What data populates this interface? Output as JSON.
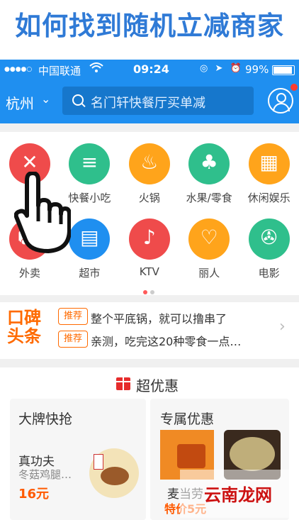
{
  "banner": {
    "title": "如何找到随机立减商家"
  },
  "status_bar": {
    "signal": "●●●●○",
    "carrier": "中国联通",
    "wifi": "wifi-icon",
    "time": "09:24",
    "icons": "◎ ➤ ⏰",
    "battery_pct": "99%",
    "battery_level": 0.99,
    "text_color": "#ffffff"
  },
  "nav": {
    "city": "杭州",
    "search_placeholder": "名门轩快餐厅买单减",
    "bg_color": "#1f8ff0"
  },
  "categories": [
    {
      "label": "",
      "icon": "fork-spoon-icon",
      "color": "#ef4b4b"
    },
    {
      "label": "快餐小吃",
      "icon": "burger-icon",
      "color": "#2fbf8c"
    },
    {
      "label": "火锅",
      "icon": "hotpot-icon",
      "color": "#ffa41b"
    },
    {
      "label": "水果/零食",
      "icon": "cherry-icon",
      "color": "#2fbf8c"
    },
    {
      "label": "休闲娱乐",
      "icon": "gameboy-icon",
      "color": "#ffa41b"
    },
    {
      "label": "外卖",
      "icon": "delivery-icon",
      "color": "#ef4b4b"
    },
    {
      "label": "超市",
      "icon": "basket-icon",
      "color": "#1f8ff0"
    },
    {
      "label": "KTV",
      "icon": "microphone-icon",
      "color": "#ef4b4b"
    },
    {
      "label": "丽人",
      "icon": "beauty-icon",
      "color": "#ffa41b"
    },
    {
      "label": "电影",
      "icon": "film-icon",
      "color": "#2fbf8c"
    }
  ],
  "pager": {
    "active": 0,
    "count": 2
  },
  "koubei": {
    "logo_line1": "口碑",
    "logo_line2": "头条",
    "items": [
      {
        "tag": "推荐",
        "text": "整个平底锅，就可以撸串了"
      },
      {
        "tag": "推荐",
        "text": "亲测，吃完这20种零食一点…"
      }
    ]
  },
  "deals": {
    "title": "超优惠",
    "brand_card": {
      "title": "大牌快抢",
      "shop": "真功夫",
      "item": "冬菇鸡腿…",
      "price": "16元"
    },
    "exclusive_card": {
      "title": "专属优惠",
      "shop": "麦当劳",
      "price": "特价5元"
    }
  },
  "watermark": "云南龙网"
}
